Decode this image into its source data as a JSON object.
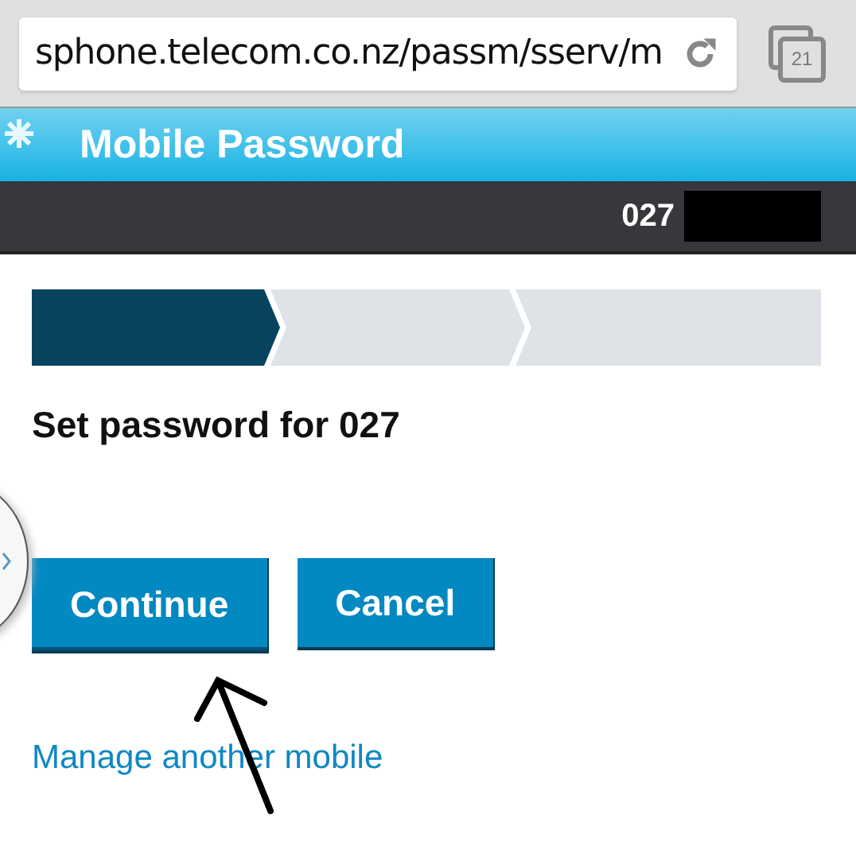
{
  "browser": {
    "url": "sphone.telecom.co.nz/passm/sserv/m",
    "tab_count": "21"
  },
  "header": {
    "title": "Mobile Password"
  },
  "account_bar": {
    "number": "027"
  },
  "steps": [
    {
      "selected": true
    },
    {
      "selected": false
    },
    {
      "selected": false
    }
  ],
  "heading": "Set password for 027",
  "buttons": [
    {
      "label": "Continue",
      "pressed": true
    },
    {
      "label": "Cancel",
      "pressed": false
    }
  ],
  "link": "Manage another mobile"
}
